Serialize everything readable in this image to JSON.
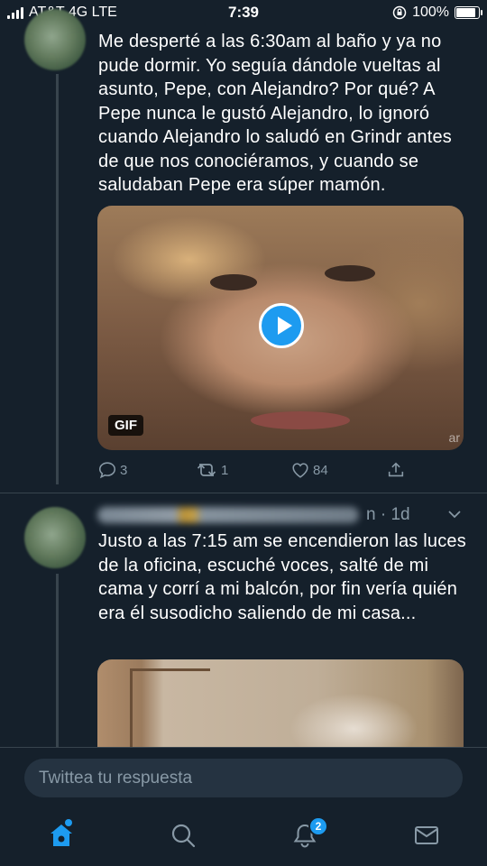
{
  "status_bar": {
    "carrier": "AT&T 4G LTE",
    "time": "7:39",
    "battery": "100%",
    "battery_level": 1.0
  },
  "tweets": [
    {
      "text": "Me desperté a las 6:30am al baño y ya no pude dormir. Yo seguía dándole vueltas al asunto, Pepe, con Alejandro? Por qué? A Pepe nunca le gustó Alejandro, lo ignoró cuando Alejandro lo saludó en Grindr antes de que nos conociéramos, y cuando se saludaban Pepe era súper mamón.",
      "media": {
        "badge": "GIF",
        "watermark": "ar"
      },
      "actions": {
        "replies": "3",
        "retweets": "1",
        "likes": "84"
      }
    },
    {
      "time": "n · 1d",
      "text": "Justo a las 7:15 am se encendieron las luces de la oficina, escuché voces, salté de mi cama y corrí a mi balcón, por fin vería quién era él susodicho saliendo de mi casa..."
    }
  ],
  "reply": {
    "placeholder": "Twittea tu respuesta"
  },
  "tab_bar": {
    "notifications_count": "2"
  },
  "colors": {
    "background": "#15202b",
    "accent": "#1d9bf0",
    "muted": "#8899a6",
    "divider": "#38444d"
  }
}
